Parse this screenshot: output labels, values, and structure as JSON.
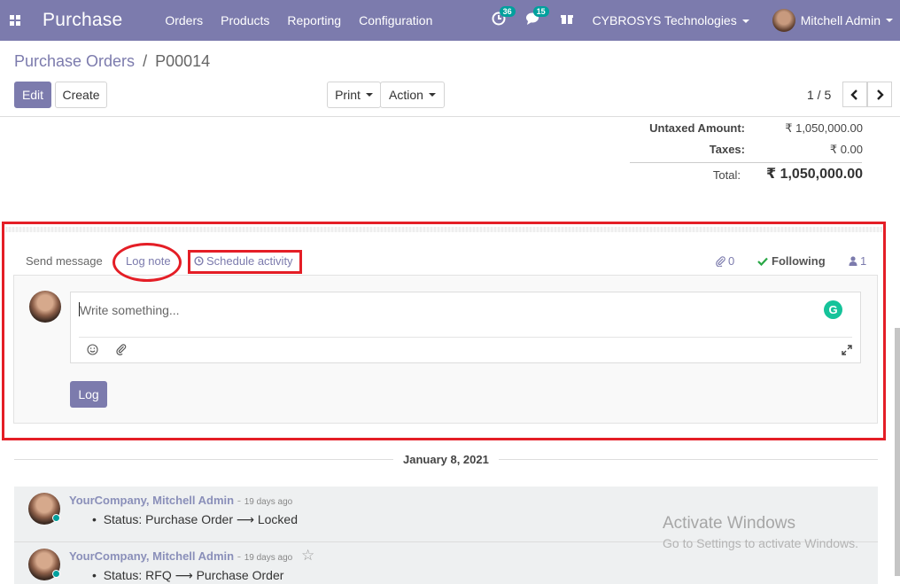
{
  "navbar": {
    "app_title": "Purchase",
    "menu": [
      "Orders",
      "Products",
      "Reporting",
      "Configuration"
    ],
    "activity_badge": "36",
    "messages_badge": "15",
    "company": "CYBROSYS Technologies",
    "user": "Mitchell Admin"
  },
  "control_panel": {
    "breadcrumb_parent": "Purchase Orders",
    "breadcrumb_sep": "/",
    "breadcrumb_current": "P00014",
    "edit_label": "Edit",
    "create_label": "Create",
    "print_label": "Print",
    "action_label": "Action",
    "pager": "1 / 5",
    "prev": "‹",
    "next": "›"
  },
  "totals": {
    "untaxed_label": "Untaxed Amount:",
    "untaxed_value": "₹ 1,050,000.00",
    "taxes_label": "Taxes:",
    "taxes_value": "₹ 0.00",
    "total_label": "Total:",
    "total_value": "₹ 1,050,000.00"
  },
  "chatter": {
    "send_message": "Send message",
    "log_note": "Log note",
    "schedule_activity": "Schedule activity",
    "attachments_count": "0",
    "following": "Following",
    "followers_count": "1",
    "composer_placeholder": "Write something...",
    "log_button": "Log",
    "annotation_color": "#e41e26"
  },
  "thread": {
    "date": "January 8, 2021",
    "messages": [
      {
        "author": "YourCompany, Mitchell Admin",
        "dash": "-",
        "when": "19 days ago",
        "status_prefix": "Status: Purchase Order",
        "arrow": "⟶",
        "status_new": "Locked"
      },
      {
        "author": "YourCompany, Mitchell Admin",
        "dash": "-",
        "when": "19 days ago",
        "status_prefix": "Status: RFQ",
        "arrow": "⟶",
        "status_new": "Purchase Order"
      }
    ]
  },
  "watermark": {
    "line1": "Activate Windows",
    "line2": "Go to Settings to activate Windows."
  },
  "colors": {
    "brand": "#7c7bad",
    "badge": "#00a09d",
    "annotation": "#e41e26"
  }
}
